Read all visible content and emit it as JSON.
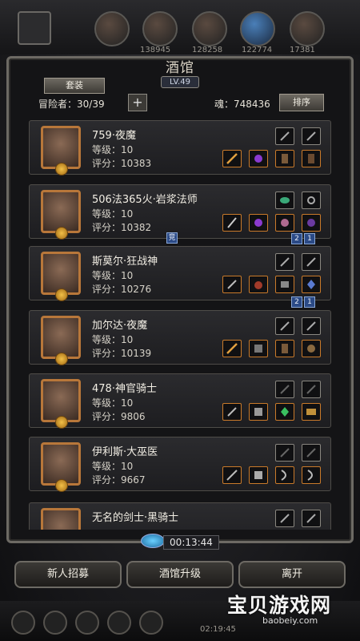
{
  "top_resources": [
    "138945",
    "128258",
    "122774",
    "17381"
  ],
  "title": "酒馆",
  "level": "LV.49",
  "suit_btn": "套装",
  "adventurers": "冒险者：30/39",
  "plus": "+",
  "soul": "魂：748436",
  "sort_btn": "排序",
  "heroes": [
    {
      "name": "759·夜魔",
      "level": "等级：10",
      "score": "评分：10383"
    },
    {
      "name": "506法365火·岩浆法师",
      "level": "等级：10",
      "score": "评分：10382"
    },
    {
      "name": "斯莫尔·狂战神",
      "level": "等级：10",
      "score": "评分：10276"
    },
    {
      "name": "加尔达·夜魔",
      "level": "等级：10",
      "score": "评分：10139"
    },
    {
      "name": "478·神官骑士",
      "level": "等级：10",
      "score": "评分：9806"
    },
    {
      "name": "伊利斯·大巫医",
      "level": "等级：10",
      "score": "评分：9667"
    },
    {
      "name": "无名的剑士·黑骑士",
      "level": "",
      "score": ""
    }
  ],
  "badges": {
    "compete": "竞",
    "two": "2",
    "one": "1"
  },
  "timer": "00:13:44",
  "buttons": {
    "recruit": "新人招募",
    "upgrade": "酒馆升级",
    "third": "离开"
  },
  "watermark": "宝贝游戏网",
  "watermark_sub": "baobeiy.com",
  "clock": "02:19:45",
  "colors": {
    "portrait_border": "#b8773a",
    "badge_blue": "#2b4a86"
  }
}
